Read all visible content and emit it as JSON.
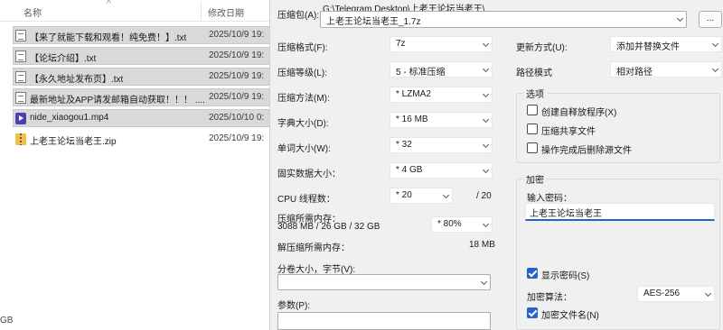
{
  "explorer": {
    "columns": {
      "name": "名称",
      "modified": "修改日期"
    },
    "files": [
      {
        "name": "【来了就能下载和观看！纯免费！】.txt",
        "date": "2025/10/9 19:",
        "icon": "text-file-icon",
        "selected": true
      },
      {
        "name": "【论坛介绍】.txt",
        "date": "2025/10/9 19:",
        "icon": "text-file-icon",
        "selected": true
      },
      {
        "name": "【永久地址发布页】.txt",
        "date": "2025/10/9 19:",
        "icon": "text-file-icon",
        "selected": true
      },
      {
        "name": "最新地址及APP请发邮箱自动获取！！！ ....",
        "date": "2025/10/9 19:",
        "icon": "text-file-icon",
        "selected": true
      },
      {
        "name": "nide_xiaogou1.mp4",
        "date": "2025/10/10 0:",
        "icon": "video-file-icon",
        "selected": true
      },
      {
        "name": "上老王论坛当老王.zip",
        "date": "2025/10/9 19:",
        "icon": "zip-file-icon",
        "selected": false
      }
    ],
    "status_fragment": "GB"
  },
  "dialog": {
    "archive": {
      "label": "压缩包(A):",
      "path": "G:\\Telegram Desktop\\上老王论坛当老王\\",
      "filename": "上老王论坛当老王_1.7z",
      "browse_label": "..."
    },
    "left": {
      "format": {
        "label": "压缩格式(F):",
        "value": "7z"
      },
      "level": {
        "label": "压缩等级(L):",
        "value": "5 - 标准压缩"
      },
      "method": {
        "label": "压缩方法(M):",
        "value": "* LZMA2"
      },
      "dict": {
        "label": "字典大小(D):",
        "value": "* 16 MB"
      },
      "word": {
        "label": "单词大小(W):",
        "value": "* 32"
      },
      "solid": {
        "label": "固实数据大小：",
        "value": "* 4 GB"
      },
      "cpu": {
        "label": "CPU 线程数：",
        "value": "* 20",
        "total": "/ 20"
      },
      "mem_compress": {
        "label": "压缩所需内存：",
        "value": "3088 MB / 26 GB / 32 GB",
        "percent": "* 80%"
      },
      "mem_decompress": {
        "label": "解压缩所需内存：",
        "value": "18 MB"
      },
      "volume": {
        "label": "分卷大小，字节(V):",
        "value": ""
      },
      "params": {
        "label": "参数(P):",
        "value": ""
      }
    },
    "right": {
      "update_mode": {
        "label": "更新方式(U):",
        "value": "添加并替换文件"
      },
      "path_mode": {
        "label": "路径模式",
        "value": "相对路径"
      },
      "options": {
        "title": "选项",
        "sfx": {
          "label": "创建自释放程序(X)",
          "checked": false
        },
        "shared": {
          "label": "压缩共享文件",
          "checked": false
        },
        "delete": {
          "label": "操作完成后删除源文件",
          "checked": false
        }
      },
      "encryption": {
        "title": "加密",
        "password_label": "输入密码：",
        "password_value": "上老王论坛当老王",
        "show_password": {
          "label": "显示密码(S)",
          "checked": true
        },
        "method_label": "加密算法：",
        "method_value": "AES-256",
        "encrypt_names": {
          "label": "加密文件名(N)",
          "checked": true
        }
      }
    }
  }
}
